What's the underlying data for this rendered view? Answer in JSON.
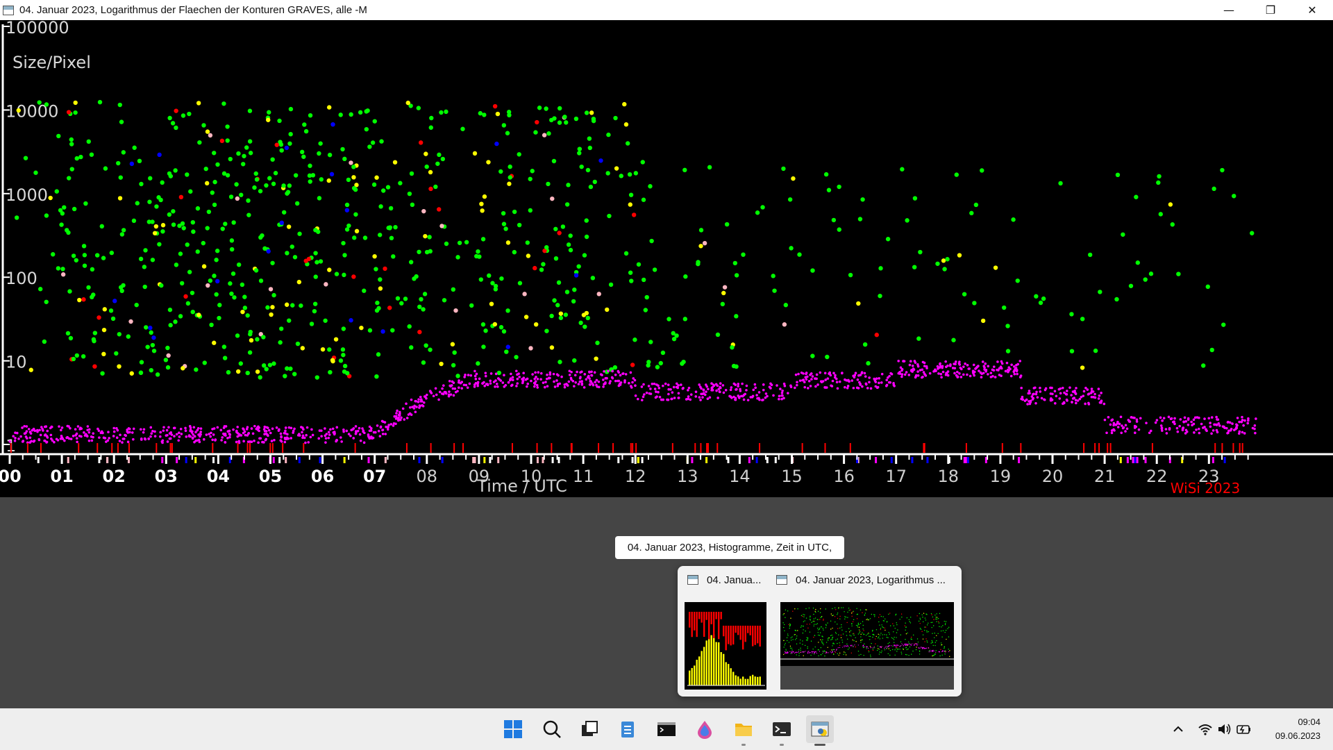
{
  "window": {
    "title": "04. Januar 2023, Logarithmus der Flaechen der Konturen GRAVES, alle -M",
    "controls": {
      "minimize": "—",
      "restore": "❐",
      "close": "✕"
    }
  },
  "chart_data": {
    "type": "scatter",
    "ylabel": "Size/Pixel",
    "xlabel": "Time / UTC",
    "yscale": "log",
    "ylim": [
      1,
      100000
    ],
    "xlim": [
      0,
      24
    ],
    "y_ticks": [
      "100000",
      "10000",
      "1000",
      "100",
      "10",
      "1"
    ],
    "x_ticks": [
      "00",
      "01",
      "02",
      "03",
      "04",
      "05",
      "06",
      "07",
      "08",
      "09",
      "10",
      "11",
      "12",
      "13",
      "14",
      "15",
      "16",
      "17",
      "18",
      "19",
      "20",
      "21",
      "22",
      "23"
    ],
    "signature": "WiSi 2023",
    "grid": false,
    "colors": {
      "background": "#000000",
      "axis": "#ffffff",
      "green": "#00ff00",
      "yellow": "#ffff00",
      "red": "#ff0000",
      "blue": "#0000ff",
      "pink": "#ffb6c1",
      "magenta": "#ff00ff"
    },
    "series_note": "Dense multi-colored scatter of contour areas per time; magenta band of small contours near the bottom"
  },
  "tooltip": {
    "text": "04. Januar 2023, Histogramme, Zeit in UTC,"
  },
  "preview": {
    "items": [
      {
        "title": "04. Janua..."
      },
      {
        "title": "04. Januar 2023, Logarithmus ..."
      }
    ]
  },
  "taskbar": {
    "icons": [
      "windows-start-icon",
      "search-icon",
      "task-view-icon",
      "notepad-icon",
      "terminal-icon",
      "paint-drop-icon",
      "file-explorer-icon",
      "console-icon",
      "python-app-icon"
    ],
    "tray_icons": [
      "chevron-up-icon",
      "wifi-icon",
      "speaker-icon",
      "battery-icon"
    ],
    "time": "09:04",
    "date": "09.06.2023"
  }
}
